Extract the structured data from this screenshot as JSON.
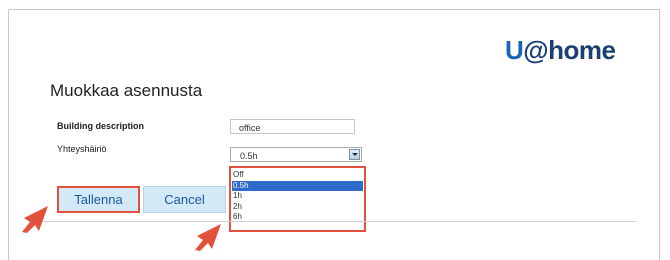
{
  "brand": {
    "logo_u": "U",
    "logo_rest": "@home"
  },
  "page": {
    "title": "Muokkaa asennusta"
  },
  "form": {
    "building_description_label": "Building description",
    "building_description_value": "office",
    "connection_label": "Yhteyshäiriö",
    "connection_value": "0.5h",
    "connection_options": [
      "Off",
      "0.5h",
      "1h",
      "2h",
      "6h"
    ],
    "connection_selected_index": 1
  },
  "buttons": {
    "save_label": "Tallenna",
    "cancel_label": "Cancel"
  },
  "colors": {
    "highlight": "#e2513b",
    "selection": "#2f6bc9",
    "button_bg": "#d4e9f8",
    "brand_blue": "#1b63b4"
  }
}
